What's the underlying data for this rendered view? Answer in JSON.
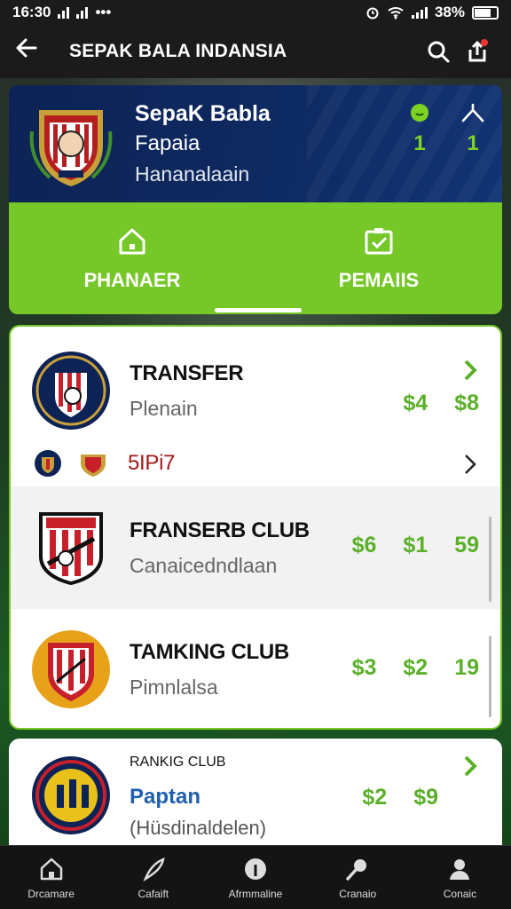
{
  "status_bar": {
    "time": "16:30",
    "battery": "38%",
    "dots": "•••"
  },
  "app_bar": {
    "title": "SEPAK BALA INDANSIA"
  },
  "hero": {
    "line1": "SepaK Babla",
    "line2": "Fapaia",
    "line3": "Hananalaain",
    "stats": [
      {
        "value": "1"
      },
      {
        "value": "1"
      }
    ],
    "tabs": [
      {
        "label": "PHANAER"
      },
      {
        "label": "PEMAIIS"
      }
    ]
  },
  "list": {
    "rows": [
      {
        "name": "TRANSFER",
        "sub": "Plenain",
        "prices": [
          "$4",
          "$8"
        ]
      },
      {
        "name": "5IPi7"
      },
      {
        "name": "FRANSERB CLUB",
        "sub": "Canaicedndlaan",
        "prices": [
          "$6",
          "$1",
          "59"
        ]
      },
      {
        "name": "TAMKING CLUB",
        "sub": "Pimnlalsa",
        "prices": [
          "$3",
          "$2",
          "19"
        ]
      }
    ]
  },
  "card2": {
    "name": "RANKIG CLUB",
    "sub": "Paptan",
    "sub2": "(Hüsdinaldelen)",
    "prices": [
      "$2",
      "$9"
    ]
  },
  "bottom_nav": [
    {
      "label": "Drcamare"
    },
    {
      "label": "Cafaift"
    },
    {
      "label": "Afrmmaline"
    },
    {
      "label": "Cranaio"
    },
    {
      "label": "Conaic"
    }
  ],
  "colors": {
    "accent_green": "#76c728",
    "price_green": "#5bb02a",
    "navy": "#0d2355",
    "sipi_red": "#a31818"
  }
}
